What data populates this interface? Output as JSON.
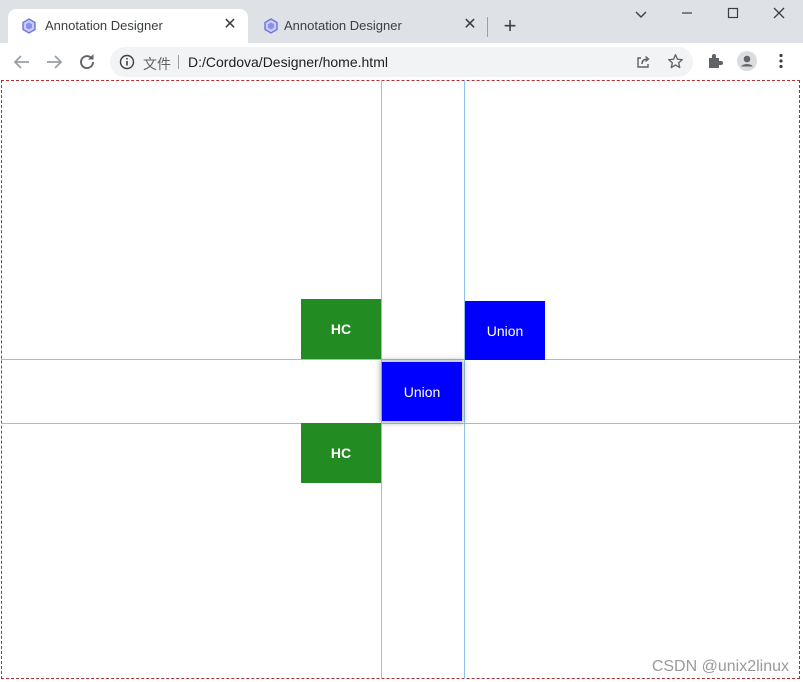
{
  "browser": {
    "tabs": [
      {
        "title": "Annotation Designer",
        "active": true
      },
      {
        "title": "Annotation Designer",
        "active": false
      }
    ],
    "close_glyph": "✕",
    "new_tab_glyph": "+",
    "window_controls": {
      "dropdown": "⌄",
      "minimize": "—",
      "maximize": "☐",
      "close": "✕"
    },
    "address_bar": {
      "scheme_label": "文件",
      "url": "D:/Cordova/Designer/home.html"
    }
  },
  "canvas": {
    "boxes": [
      {
        "label": "HC",
        "color": "#228b22"
      },
      {
        "label": "Union",
        "color": "#0000ff"
      },
      {
        "label": "Union",
        "color": "#0000ff",
        "selected": true
      },
      {
        "label": "HC",
        "color": "#228b22"
      }
    ],
    "guide_color": "#8ec3e6",
    "frame_color": "#b03030"
  },
  "watermark": "CSDN @unix2linux",
  "icons": [
    "favicon-hexagon-icon",
    "back-arrow-icon",
    "forward-arrow-icon",
    "reload-icon",
    "info-icon",
    "share-icon",
    "star-icon",
    "extensions-icon",
    "profile-icon",
    "menu-kebab-icon"
  ]
}
